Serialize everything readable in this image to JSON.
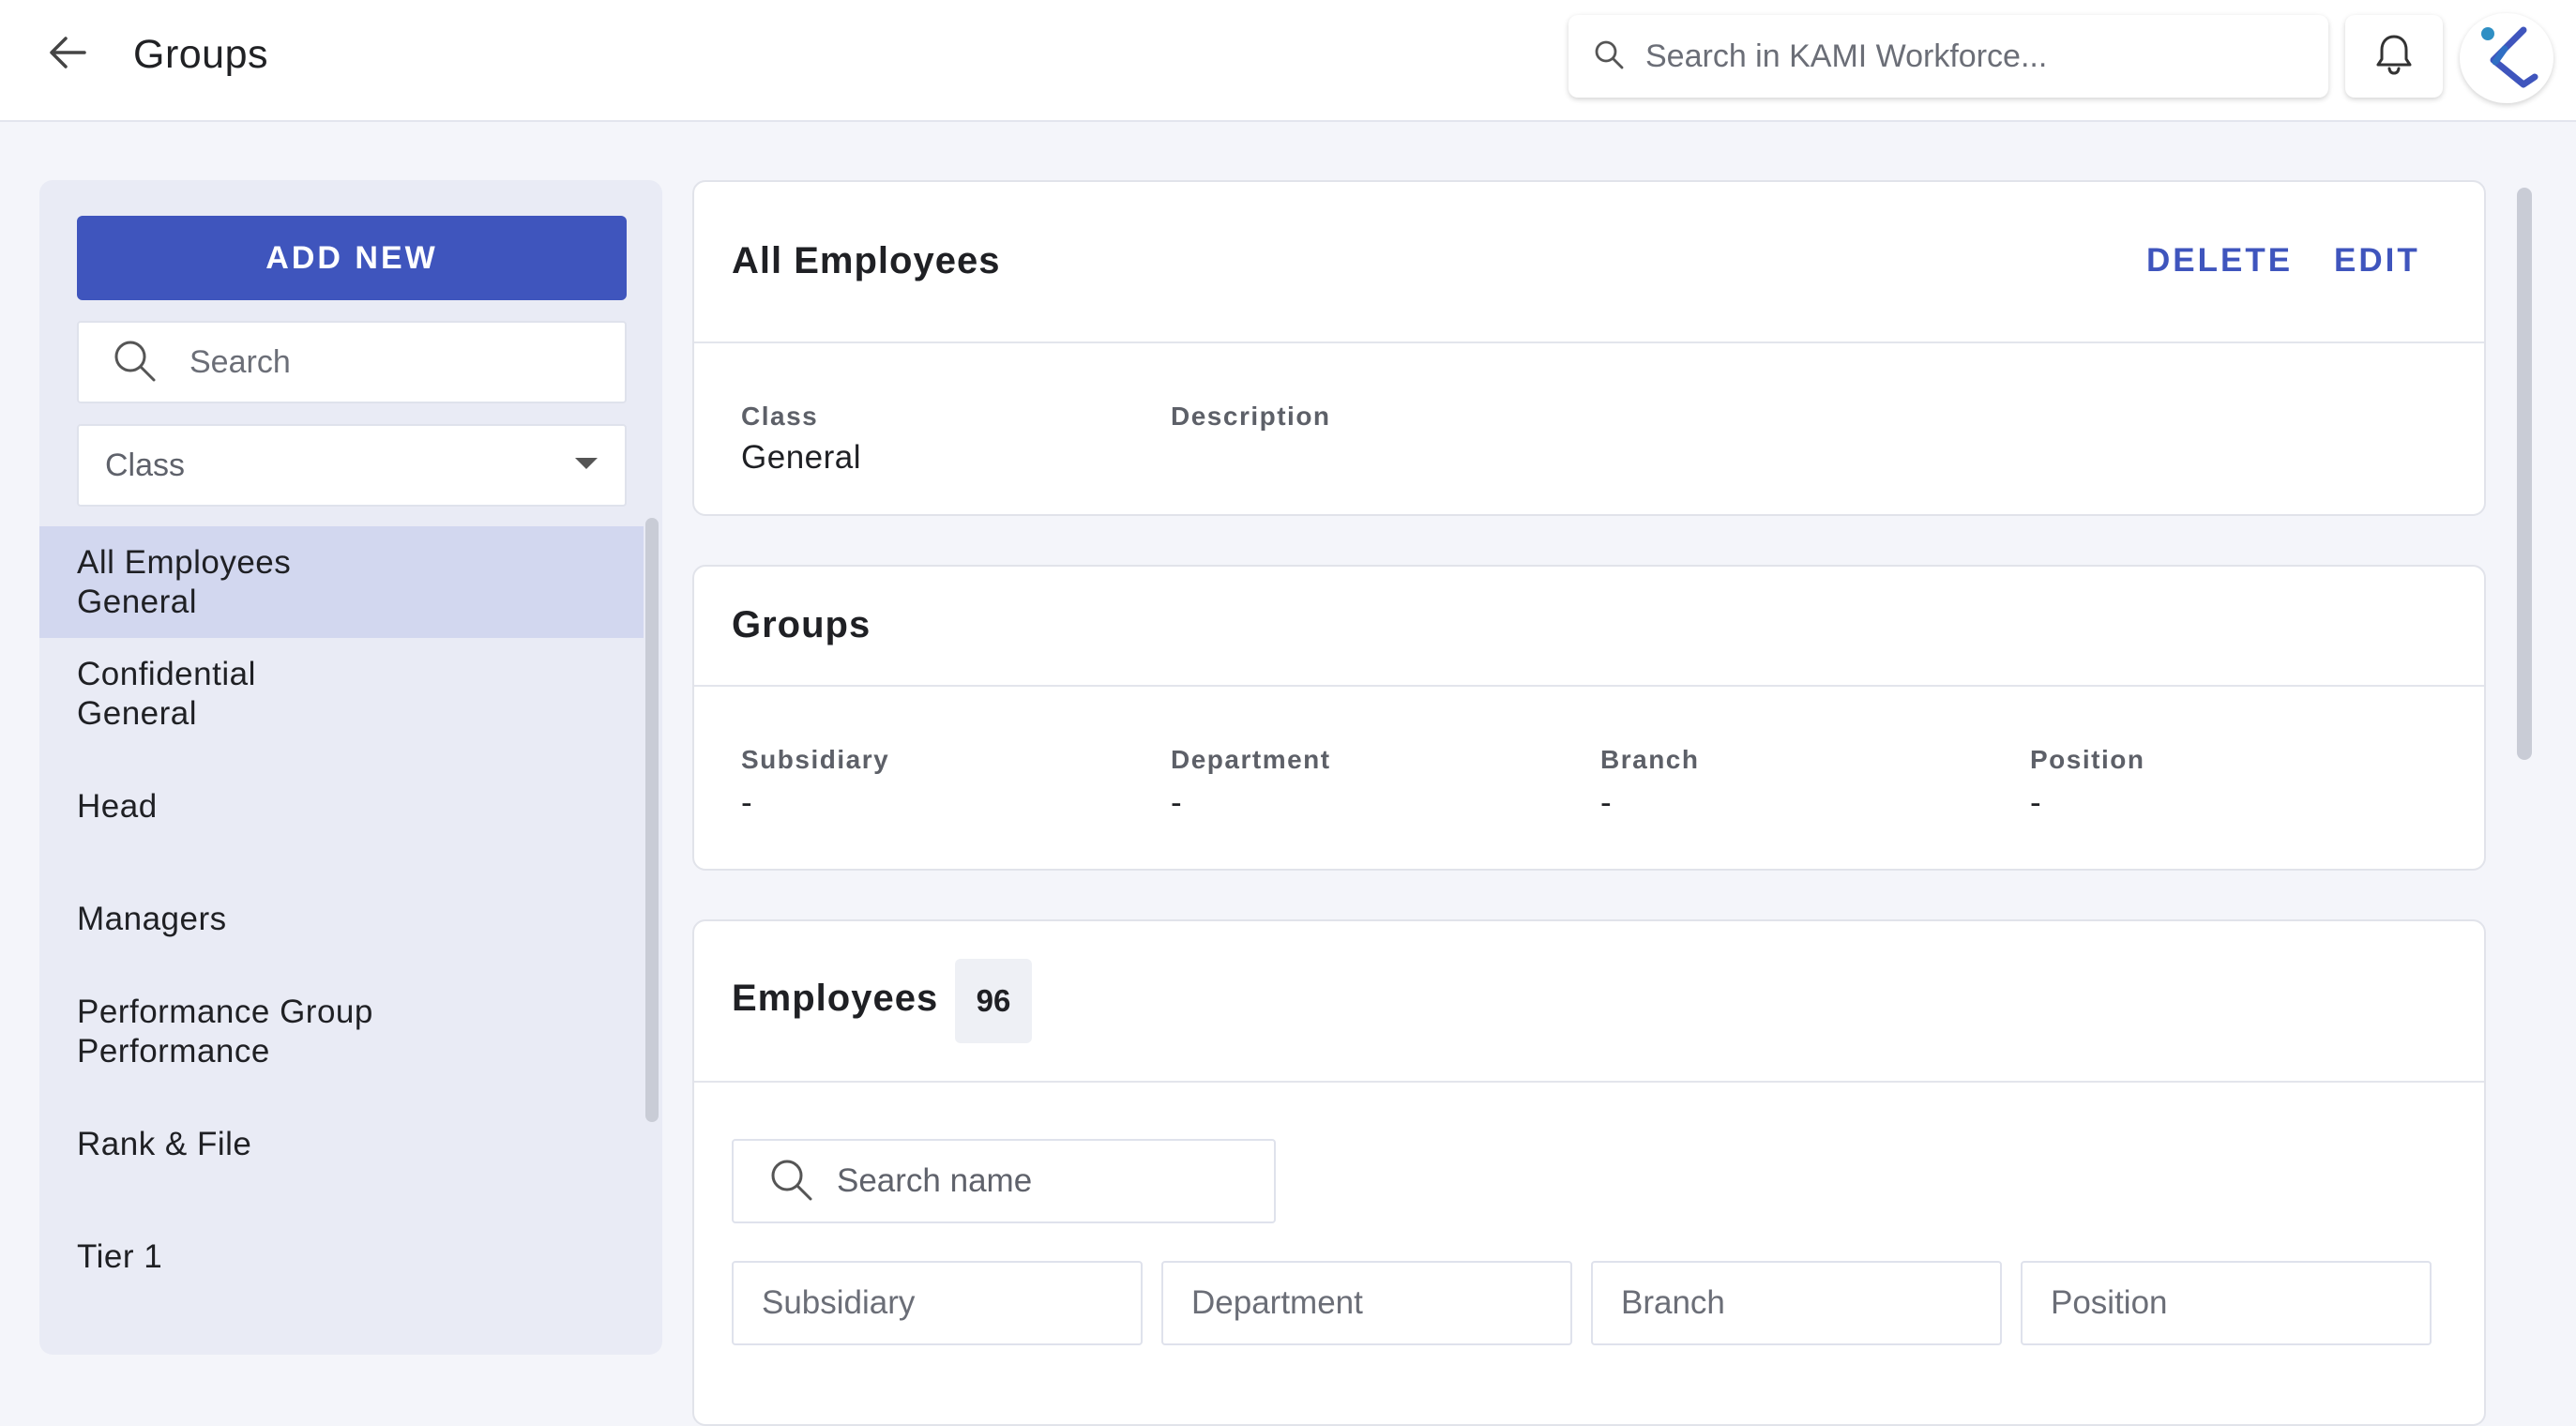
{
  "header": {
    "title": "Groups",
    "search_placeholder": "Search in KAMI Workforce..."
  },
  "sidebar": {
    "add_new_label": "ADD NEW",
    "search_placeholder": "Search",
    "class_filter_label": "Class",
    "items": [
      {
        "name": "All Employees",
        "class": "General",
        "selected": true
      },
      {
        "name": "Confidential",
        "class": "General",
        "selected": false
      },
      {
        "name": "Head",
        "class": "",
        "selected": false
      },
      {
        "name": "Managers",
        "class": "",
        "selected": false
      },
      {
        "name": "Performance Group",
        "class": "Performance",
        "selected": false
      },
      {
        "name": "Rank & File",
        "class": "",
        "selected": false
      },
      {
        "name": "Tier 1",
        "class": "",
        "selected": false
      }
    ]
  },
  "detail": {
    "title": "All Employees",
    "delete_label": "DELETE",
    "edit_label": "EDIT",
    "class_label": "Class",
    "class_value": "General",
    "description_label": "Description",
    "description_value": ""
  },
  "groups_card": {
    "title": "Groups",
    "fields": [
      {
        "label": "Subsidiary",
        "value": "-"
      },
      {
        "label": "Department",
        "value": "-"
      },
      {
        "label": "Branch",
        "value": "-"
      },
      {
        "label": "Position",
        "value": "-"
      }
    ]
  },
  "employees_card": {
    "title": "Employees",
    "count": "96",
    "search_placeholder": "Search name",
    "filters": [
      "Subsidiary",
      "Department",
      "Branch",
      "Position"
    ]
  },
  "colors": {
    "accent": "#3f55bd",
    "selected_item": "#d2d7ef",
    "sidebar_bg": "#e9ebf5",
    "page_bg": "#f4f5fa"
  }
}
